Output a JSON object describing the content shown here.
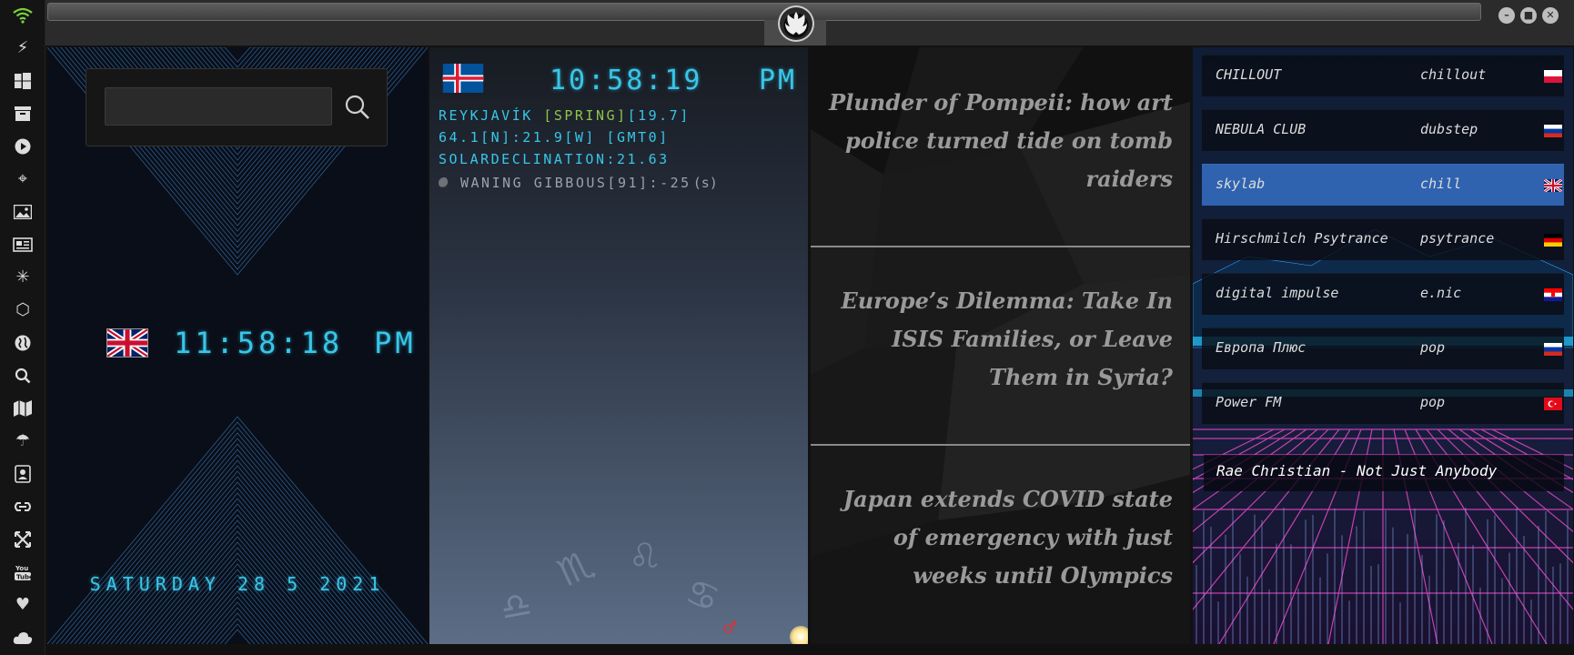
{
  "panel1": {
    "search": {
      "value": "",
      "placeholder": ""
    },
    "clock": {
      "time": "11:58:18",
      "ampm": "PM",
      "flag": "united-kingdom"
    },
    "date": "SATURDAY 28 5 2021"
  },
  "panel2": {
    "flag": "iceland",
    "time": "10:58:19",
    "ampm": "PM",
    "city": "REYKJAVÍK",
    "season": "[SPRING]",
    "temp": "[19.7]",
    "coords": "64.1[N]:21.9[W] [GMT0]",
    "solar": "SOLARDECLINATION:21.63",
    "moon": "WANING GIBBOUS[91]:-25",
    "moon_unit": "(s)"
  },
  "news": [
    "Plunder of Pompeii: how art police turned tide on tomb raiders",
    "Europe’s Dilemma: Take In ISIS Families, or Leave Them in Syria?",
    "Japan extends COVID state of emergency with just weeks until Olympics"
  ],
  "radio": {
    "stations": [
      {
        "name": "CHILLOUT",
        "genre": "chillout",
        "flag": "poland"
      },
      {
        "name": "NEBULA CLUB",
        "genre": "dubstep",
        "flag": "russia"
      },
      {
        "name": "skylab",
        "genre": "chill",
        "flag": "united-kingdom"
      },
      {
        "name": "Hirschmilch Psytrance",
        "genre": "psytrance",
        "flag": "germany"
      },
      {
        "name": "digital impulse",
        "genre": "e.nic",
        "flag": "croatia"
      },
      {
        "name": "Европа Плюс",
        "genre": "pop",
        "flag": "russia"
      },
      {
        "name": "Power FM",
        "genre": "pop",
        "flag": "turkey"
      }
    ],
    "now_playing": "Rae Christian - Not Just Anybody"
  },
  "icons": {
    "rail": [
      "wifi-icon",
      "bolt-icon",
      "windows-icon",
      "archive-icon",
      "play-icon",
      "map-pin-icon",
      "image-icon",
      "news-icon",
      "asterisk-icon",
      "hexagon-icon",
      "globe-icon",
      "search-icon",
      "map-icon",
      "umbrella-icon",
      "contact-icon",
      "link-icon",
      "expand-icon",
      "youtube-icon",
      "heart-icon",
      "cloud-icon"
    ],
    "window": [
      "minimize-icon",
      "maximize-icon",
      "close-icon"
    ]
  },
  "colors": {
    "digital": "#38c6e8",
    "selected_station": "#2f63b0",
    "wifi": "#7bd13d"
  }
}
